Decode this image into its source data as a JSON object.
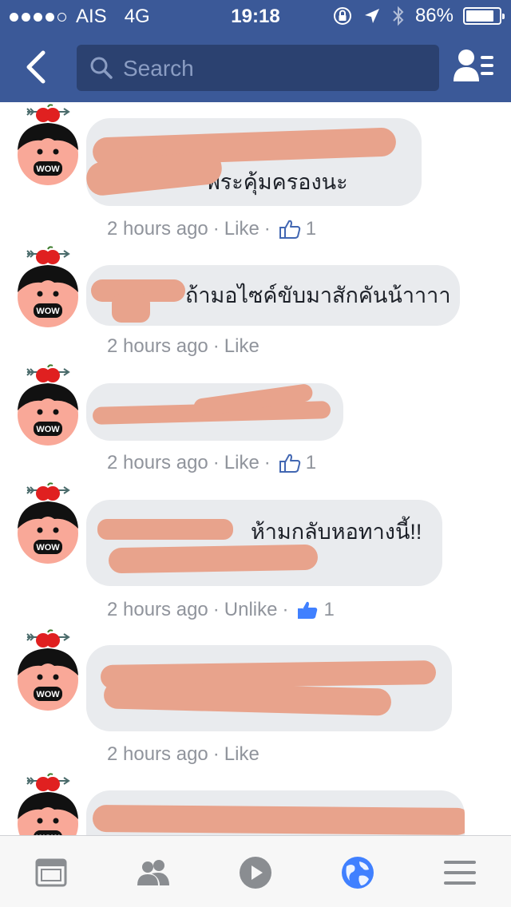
{
  "status_bar": {
    "carrier": "AIS",
    "network": "4G",
    "time": "19:18",
    "battery": "86%",
    "battery_level": 0.86
  },
  "nav": {
    "search_placeholder": "Search"
  },
  "comments": [
    {
      "text": "พระคุ้มครองนะ",
      "time": "2 hours ago",
      "action": "Like",
      "likes": "1",
      "liked": false
    },
    {
      "text": "ถ้ามอไซค์ขับมาสักคันน้าาาา",
      "time": "2 hours ago",
      "action": "Like",
      "likes": null,
      "liked": false
    },
    {
      "text": "",
      "time": "2 hours ago",
      "action": "Like",
      "likes": "1",
      "liked": false
    },
    {
      "text": "ห้ามกลับหอทางนี้!!",
      "time": "2 hours ago",
      "action": "Unlike",
      "likes": "1",
      "liked": true
    },
    {
      "text": "",
      "time": "2 hours ago",
      "action": "Like",
      "likes": null,
      "liked": false
    },
    {
      "text": "",
      "time": "",
      "action": "",
      "likes": null,
      "liked": false
    }
  ],
  "avatar_text": "WOW",
  "colors": {
    "brand": "#3b5998",
    "bubble": "#e9ebee",
    "meta": "#90949c",
    "liked": "#4080ff",
    "redaction": "#e8a38c"
  },
  "tabs": [
    "news-feed-icon",
    "friends-icon",
    "video-icon",
    "notifications-globe-icon",
    "menu-icon"
  ]
}
